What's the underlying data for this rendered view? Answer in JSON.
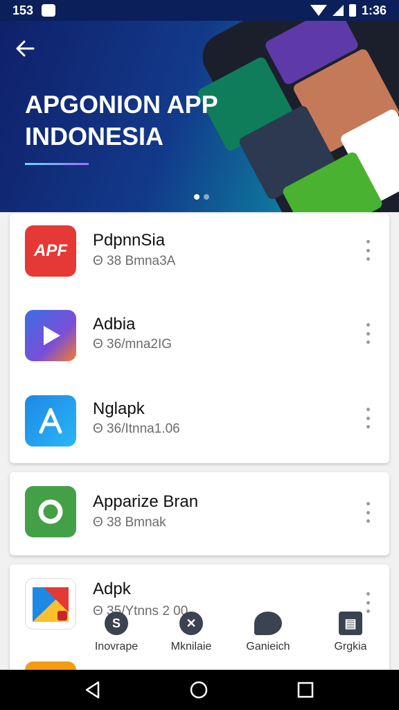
{
  "status_bar": {
    "left_text": "153",
    "time": "1:36"
  },
  "hero": {
    "title_line1": "APGONION APP",
    "title_line2": "INDONESIA",
    "accent_color": "#6fd8ff"
  },
  "apps_group1": [
    {
      "name": "PdpnnSia",
      "meta": "Θ 38 Bmna3A"
    },
    {
      "name": "Adbia",
      "meta": "Θ 36/mna2IG"
    },
    {
      "name": "Nglapk",
      "meta": "Θ 36/Itnna1.06"
    }
  ],
  "apps_group2": [
    {
      "name": "Apparize Bran",
      "meta": "Θ 38 Bmnak"
    }
  ],
  "apps_group3": [
    {
      "name": "Adpk",
      "meta": "Θ 35/Ytnns 2 00"
    }
  ],
  "app_icons": {
    "first_badge": "APF",
    "colors": [
      "#e53935",
      "#3b6ee3",
      "#1e88e5",
      "#43a047",
      "#ffffff"
    ]
  },
  "bottom_nav": [
    {
      "label": "Inovrape",
      "icon": "s-circle-icon"
    },
    {
      "label": "Mknilaie",
      "icon": "x-circle-icon"
    },
    {
      "label": "Ganieich",
      "icon": "chat-icon"
    },
    {
      "label": "Grgkia",
      "icon": "calendar-icon"
    }
  ]
}
